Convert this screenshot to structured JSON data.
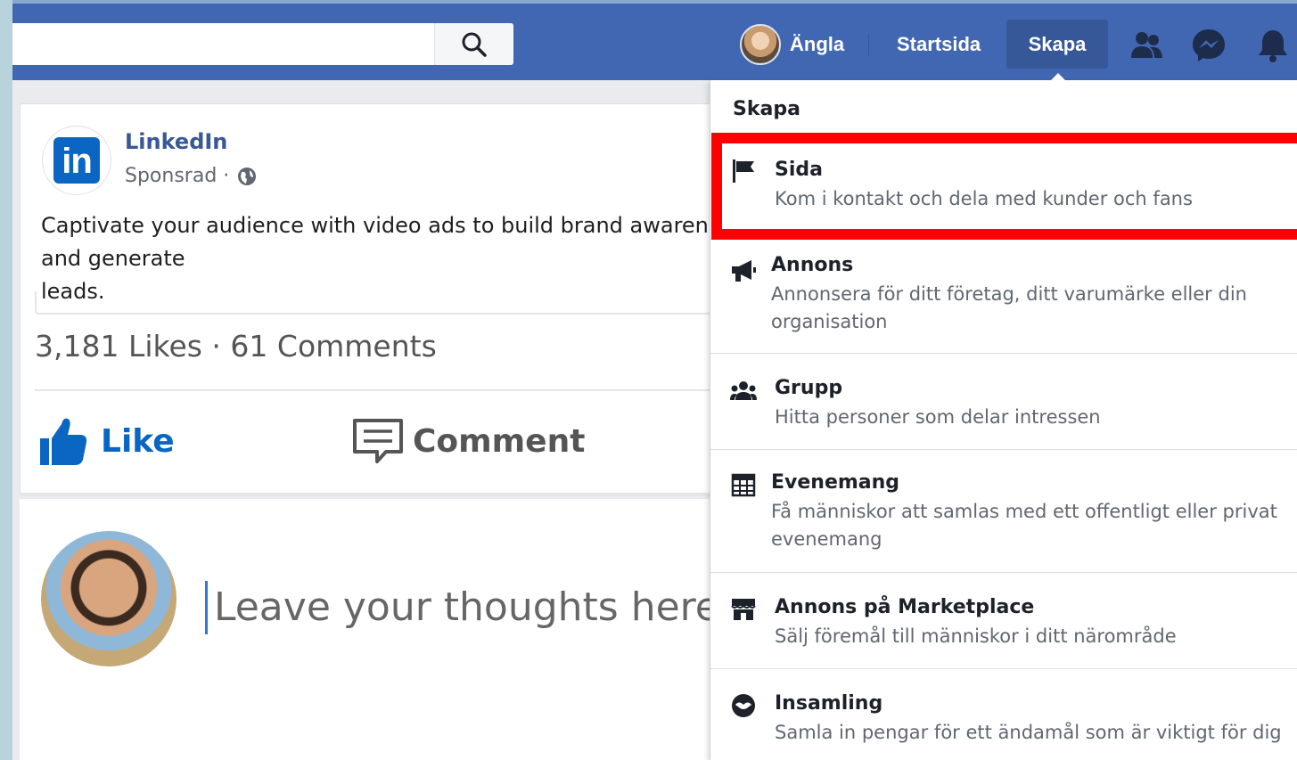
{
  "topbar": {
    "user_name": "Ängla",
    "home_label": "Startsida",
    "create_label": "Skapa"
  },
  "post": {
    "advertiser": "LinkedIn",
    "sponsored": "Sponsrad ·",
    "text": "Captivate your audience with video ads to build brand awareness and generate\nleads.",
    "stats": "3,181 Likes · 61 Comments",
    "like_label": "Like",
    "comment_label": "Comment",
    "comment_placeholder": "Leave your thoughts here..."
  },
  "dropdown": {
    "header": "Skapa",
    "items": [
      {
        "title": "Sida",
        "desc": "Kom i kontakt och dela med kunder och fans",
        "icon": "flag-icon"
      },
      {
        "title": "Annons",
        "desc": "Annonsera för ditt företag, ditt varumärke eller din organisation",
        "icon": "megaphone-icon"
      },
      {
        "title": "Grupp",
        "desc": "Hitta personer som delar intressen",
        "icon": "group-icon"
      },
      {
        "title": "Evenemang",
        "desc": "Få människor att samlas med ett offentligt eller privat evenemang",
        "icon": "calendar-icon"
      },
      {
        "title": "Annons på Marketplace",
        "desc": "Sälj föremål till människor i ditt närområde",
        "icon": "shop-icon"
      },
      {
        "title": "Insamling",
        "desc": "Samla in pengar för ett ändamål som är viktigt för dig",
        "icon": "fundraiser-icon"
      }
    ]
  },
  "colors": {
    "facebook_blue": "#4267b2",
    "linkedin_blue": "#0a66c2",
    "highlight_red": "#ff0000"
  }
}
